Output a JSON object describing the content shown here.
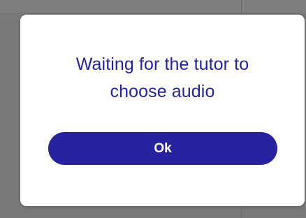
{
  "dialog": {
    "message_line1": "Waiting for the tutor to",
    "message_line2": "choose audio",
    "ok_label": "Ok"
  },
  "colors": {
    "accent": "#27229f",
    "message_text": "#2323a8",
    "overlay": "#787878",
    "dialog_bg": "#ffffff"
  }
}
